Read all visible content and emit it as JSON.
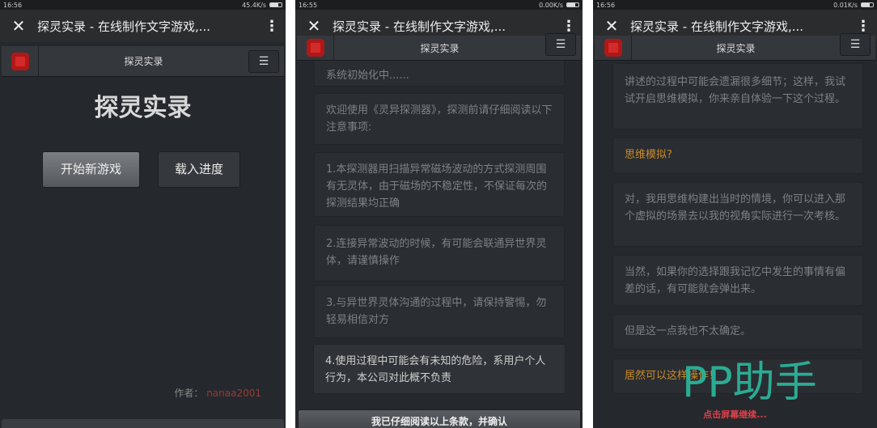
{
  "browser_title": "探灵实录 - 在线制作文字游戏,...",
  "app_title": "探灵实录",
  "screens": [
    {
      "time": "16:56",
      "speed": "45.4K/s",
      "game_title": "探灵实录",
      "new_game": "开始新游戏",
      "load_game": "载入进度",
      "author_label": "作者：",
      "author": "nanaa2001"
    },
    {
      "time": "16:55",
      "speed": "0.00K/s",
      "cards": [
        "系统初始化中......",
        "欢迎使用《灵异探测器》，探测前请仔细阅读以下注意事项:",
        "1.本探测器用扫描异常磁场波动的方式探测周围有无灵体，由于磁场的不稳定性，不保证每次的探测结果均正确",
        "2.连接异常波动的时候，有可能会联通异世界灵体，请谨慎操作",
        "3.与异世界灵体沟通的过程中，请保持警惕，勿轻易相信对方",
        "4.使用过程中可能会有未知的危险，系用户个人行为，本公司对此概不负责"
      ],
      "confirm": "我已仔细阅读以上条款，并确认"
    },
    {
      "time": "16:56",
      "speed": "0.01K/s",
      "cards": [
        "讲述的过程中可能会遗漏很多细节；这样，我试试开启思维模拟，你来亲自体验一下这个过程。",
        "思维模拟?",
        "对，我用思维构建出当时的情境，你可以进入那个虚拟的场景去以我的视角实际进行一次考核。",
        "当然，如果你的选择跟我记忆中发生的事情有偏差的话，有可能就会弹出来。",
        "但是这一点我也不太确定。",
        "居然可以这样操作！"
      ],
      "continue": "点击屏幕继续..."
    }
  ],
  "watermark": "PP助手",
  "colors": {
    "accent_orange": "#c98a2a",
    "author_red": "#9a3a3a",
    "continue_red": "#e0404a",
    "watermark": "#2bb39a"
  }
}
